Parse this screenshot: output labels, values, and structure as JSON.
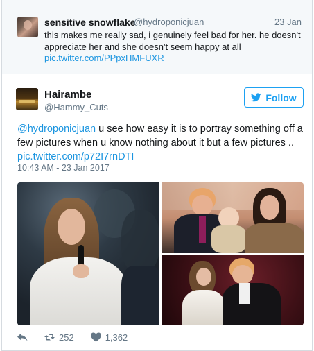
{
  "parent_tweet": {
    "name": "sensitive snowflake",
    "handle": "@hydroponicjuan",
    "date": "23 Jan",
    "text": "this makes me really sad, i genuinely feel bad for her. he doesn't appreciate her and she doesn't seem happy at all",
    "link": "pic.twitter.com/PPpxHMFUXR"
  },
  "tweet": {
    "name": "Hairambe",
    "handle": "@Hammy_Cuts",
    "follow_label": "Follow",
    "mention": "@hydroponicjuan",
    "text_line1_rest": " u see how easy it is to portray something off a few pictures when u know nothing about it but a few pictures ..",
    "link": "pic.twitter.com/p72I7rnDTI",
    "timestamp": "10:43 AM - 23 Jan 2017"
  },
  "actions": {
    "retweets": "252",
    "likes": "1,362"
  },
  "colors": {
    "accent": "#1da1f2",
    "link": "#1b95e0",
    "muted": "#657786"
  },
  "icons": [
    "reply-icon",
    "retweet-icon",
    "heart-icon",
    "twitter-bird-icon"
  ]
}
